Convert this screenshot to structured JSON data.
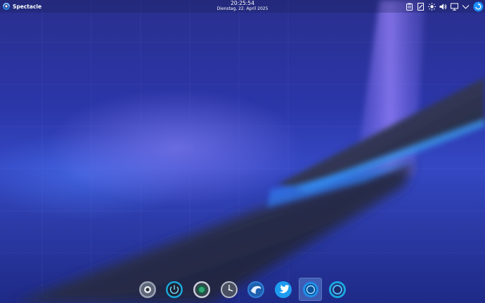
{
  "app_menu": {
    "label": "Spectacle",
    "icon": "spectacle-icon"
  },
  "clock": {
    "time": "20:25:54",
    "date": "Dienstag, 22. April 2025"
  },
  "tray": {
    "items": [
      {
        "name": "clipboard-icon"
      },
      {
        "name": "notes-icon"
      },
      {
        "name": "brightness-icon"
      },
      {
        "name": "volume-icon"
      },
      {
        "name": "display-icon"
      },
      {
        "name": "expand-tray-icon"
      },
      {
        "name": "updates-icon"
      }
    ]
  },
  "dock": {
    "items": [
      {
        "name": "system-settings-icon"
      },
      {
        "name": "power-icon"
      },
      {
        "name": "monitor-app-icon"
      },
      {
        "name": "clock-app-icon"
      },
      {
        "name": "dolphin-icon"
      },
      {
        "name": "twitter-icon"
      },
      {
        "name": "spectacle-app-icon",
        "active": true
      },
      {
        "name": "ring-app-icon"
      }
    ]
  },
  "colors": {
    "background_top": "#2a2f8e",
    "background_mid": "#3548c4",
    "accent": "#1e90ff",
    "active_highlight": "#78b4ff"
  }
}
